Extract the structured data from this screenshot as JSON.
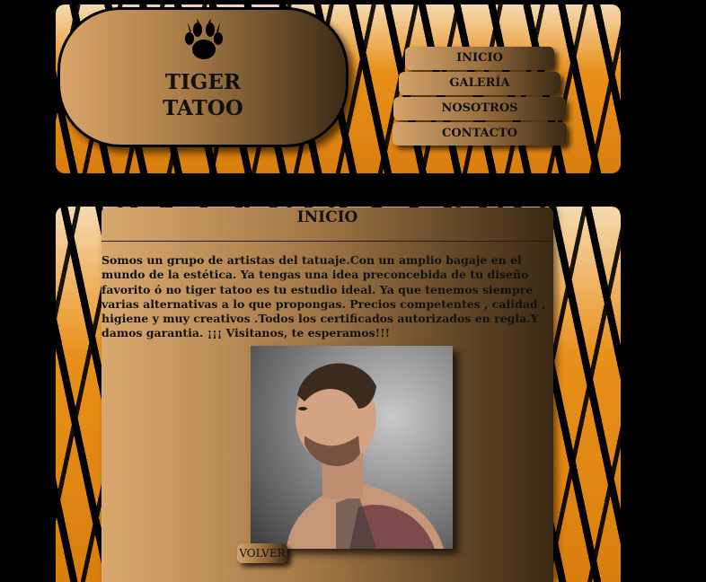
{
  "logo": {
    "icon": "paw-print-icon",
    "line1": "TIGER",
    "line2": "TATOO"
  },
  "nav": [
    {
      "label": "INICIO"
    },
    {
      "label": "GALERÍA"
    },
    {
      "label": "NOSOTROS"
    },
    {
      "label": "CONTACTO"
    }
  ],
  "main": {
    "title": "INICIO",
    "body": "Somos un grupo de artistas del tatuaje.Con un amplio bagaje en el mundo de la estética. Ya tengas una idea preconcebida de tu diseño favorito ó no tiger tatoo es tu estudio ideal. Ya que tenemos siempre varias alternativas a lo que propongas. Precios competentes , calidad , higiene y muy creativos .Todos los certificados autorizados en regla.Y damos garantia. ¡¡¡ Visitanos, te esperamos!!!",
    "back_label": "VOLVER"
  },
  "colors": {
    "tiger_orange": "#e8901a",
    "panel_light": "#d9a86e",
    "panel_dark": "#3a2813"
  }
}
